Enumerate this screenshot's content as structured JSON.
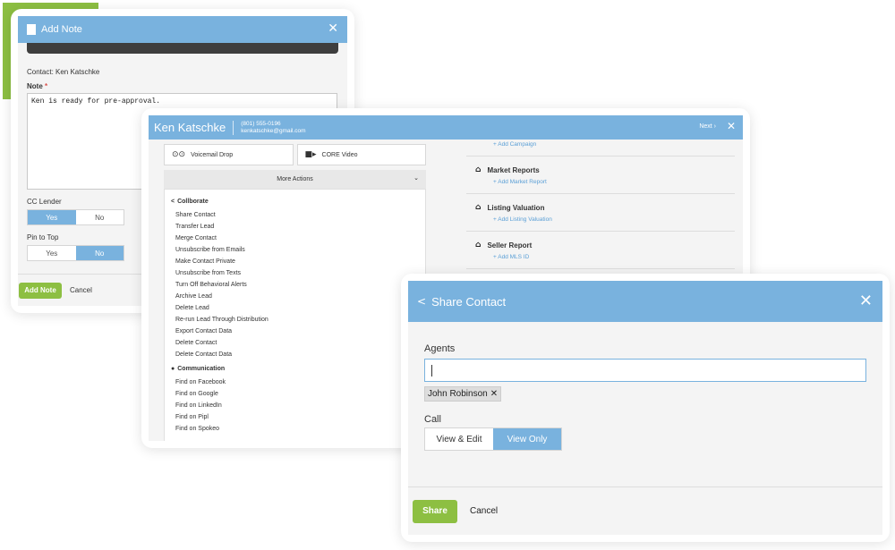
{
  "add_note": {
    "title": "Add Note",
    "contact_line": "Contact: Ken Katschke",
    "note_label": "Note",
    "required_mark": "*",
    "note_text": "Ken is ready for pre-approval.",
    "cc_lender": {
      "label": "CC Lender",
      "options": [
        "Yes",
        "No"
      ],
      "selected": "Yes"
    },
    "pin_to_top": {
      "label": "Pin to Top",
      "options": [
        "Yes",
        "No"
      ],
      "selected": "No"
    },
    "footer": {
      "primary": "Add Note",
      "cancel": "Cancel"
    }
  },
  "contact": {
    "name": "Ken Katschke",
    "phone": "(801) 555-0196",
    "email": "kenkatschke@gmail.com",
    "next_label": "Next ›",
    "buttons": {
      "voicemail": "Voicemail Drop",
      "video": "CORE Video"
    },
    "more_actions": "More Actions",
    "menu": {
      "collaborate_title": "Collborate",
      "collaborate_items": [
        "Share Contact",
        "Transfer Lead",
        "Merge Contact",
        "Unsubscribe from Emails",
        "Make Contact Private",
        "Unsubscribe from Texts",
        "Turn Off Behavioral Alerts",
        "Archive Lead",
        "Delete Lead",
        "Re-run Lead Through Distribution",
        "Export Contact Data",
        "Delete Contact",
        "Delete Contact Data"
      ],
      "communication_title": "Communication",
      "communication_items": [
        "Find on Facebook",
        "Find on Google",
        "Find on LinkedIn",
        "Find on Pipl",
        "Find on Spokeo"
      ]
    },
    "right": {
      "add_campaign": "+ Add Campaign",
      "sections": [
        {
          "title": "Market Reports",
          "link": "+ Add Market Report"
        },
        {
          "title": "Listing Valuation",
          "link": "+ Add Listing Valuation"
        },
        {
          "title": "Seller Report",
          "link": "+ Add MLS ID"
        }
      ]
    }
  },
  "share": {
    "title": "Share Contact",
    "agents_label": "Agents",
    "agents_input_value": "",
    "chip": "John Robinson",
    "call_label": "Call",
    "call_options": [
      "View & Edit",
      "View Only"
    ],
    "call_selected": "View Only",
    "footer": {
      "primary": "Share",
      "cancel": "Cancel"
    }
  },
  "colors": {
    "accent_blue": "#79b2de",
    "accent_green": "#8dbf42",
    "link_blue": "#5a9fd6"
  }
}
